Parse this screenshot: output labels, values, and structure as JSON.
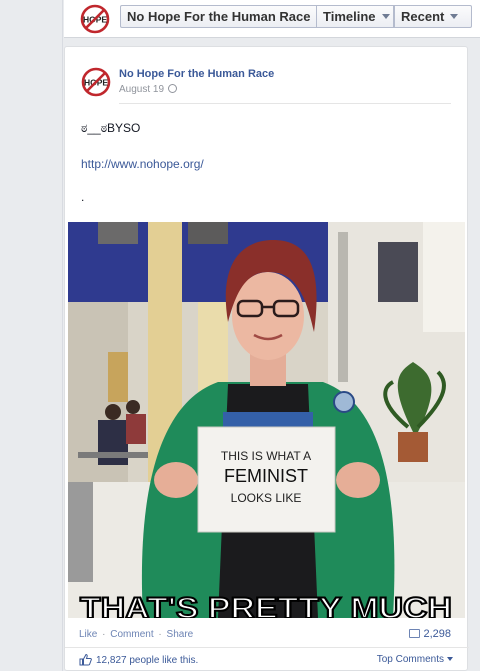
{
  "topbar": {
    "logo_text": "HOPE",
    "page_name": "No Hope For the Human Race",
    "timeline_label": "Timeline",
    "recent_label": "Recent"
  },
  "post": {
    "author": "No Hope For the Human Race",
    "date": "August 19",
    "text": "ಠ__ಠBYSO",
    "link": "http://www.nohope.org/",
    "dot": ".",
    "photo": {
      "sign_line1": "THIS IS WHAT A",
      "sign_line2": "FEMINIST",
      "sign_line3": "LOOKS LIKE",
      "caption": "THAT'S PRETTY MUCH"
    },
    "actions": {
      "like": "Like",
      "comment": "Comment",
      "share": "Share",
      "separator": "·"
    },
    "comment_count": "2,298",
    "likes_text": "12,827 people like this.",
    "top_comments": "Top Comments"
  },
  "colors": {
    "brand_blue": "#3b5998",
    "logo_red": "#c0272d"
  }
}
